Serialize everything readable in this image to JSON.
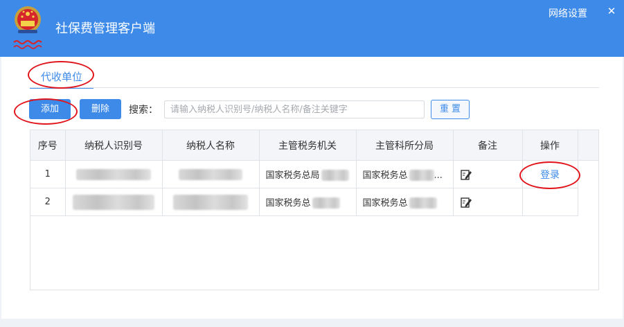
{
  "header": {
    "title": "社保费管理客户端",
    "network_settings": "网络设置",
    "close_symbol": "✕",
    "logo_icon": "tax-emblem-icon",
    "brand_color": "#3d8ae9"
  },
  "tabs": [
    {
      "label": "代收单位",
      "active": true
    }
  ],
  "toolbar": {
    "add_label": "添加",
    "delete_label": "删除",
    "search_label": "搜索：",
    "search_placeholder": "请输入纳税人识别号/纳税人名称/备注关键字",
    "search_value": "",
    "reset_label": "重 置"
  },
  "table": {
    "columns": [
      "序号",
      "纳税人识别号",
      "纳税人名称",
      "主管税务机关",
      "主管科所分局",
      "备注",
      "操作"
    ],
    "rows": [
      {
        "index": "1",
        "tax_id": "",
        "taxpayer_name": "",
        "tax_authority": "国家税务总局",
        "branch_bureau": "国家税务总",
        "branch_suffix": "...",
        "note_icon": "edit-note-icon",
        "action": "登录"
      },
      {
        "index": "2",
        "tax_id": "",
        "taxpayer_name": "",
        "tax_authority": "国家税务总",
        "branch_bureau": "国家税务总",
        "branch_suffix": "",
        "note_icon": "edit-note-icon",
        "action": ""
      }
    ]
  },
  "annotation_color": "#e1141b"
}
